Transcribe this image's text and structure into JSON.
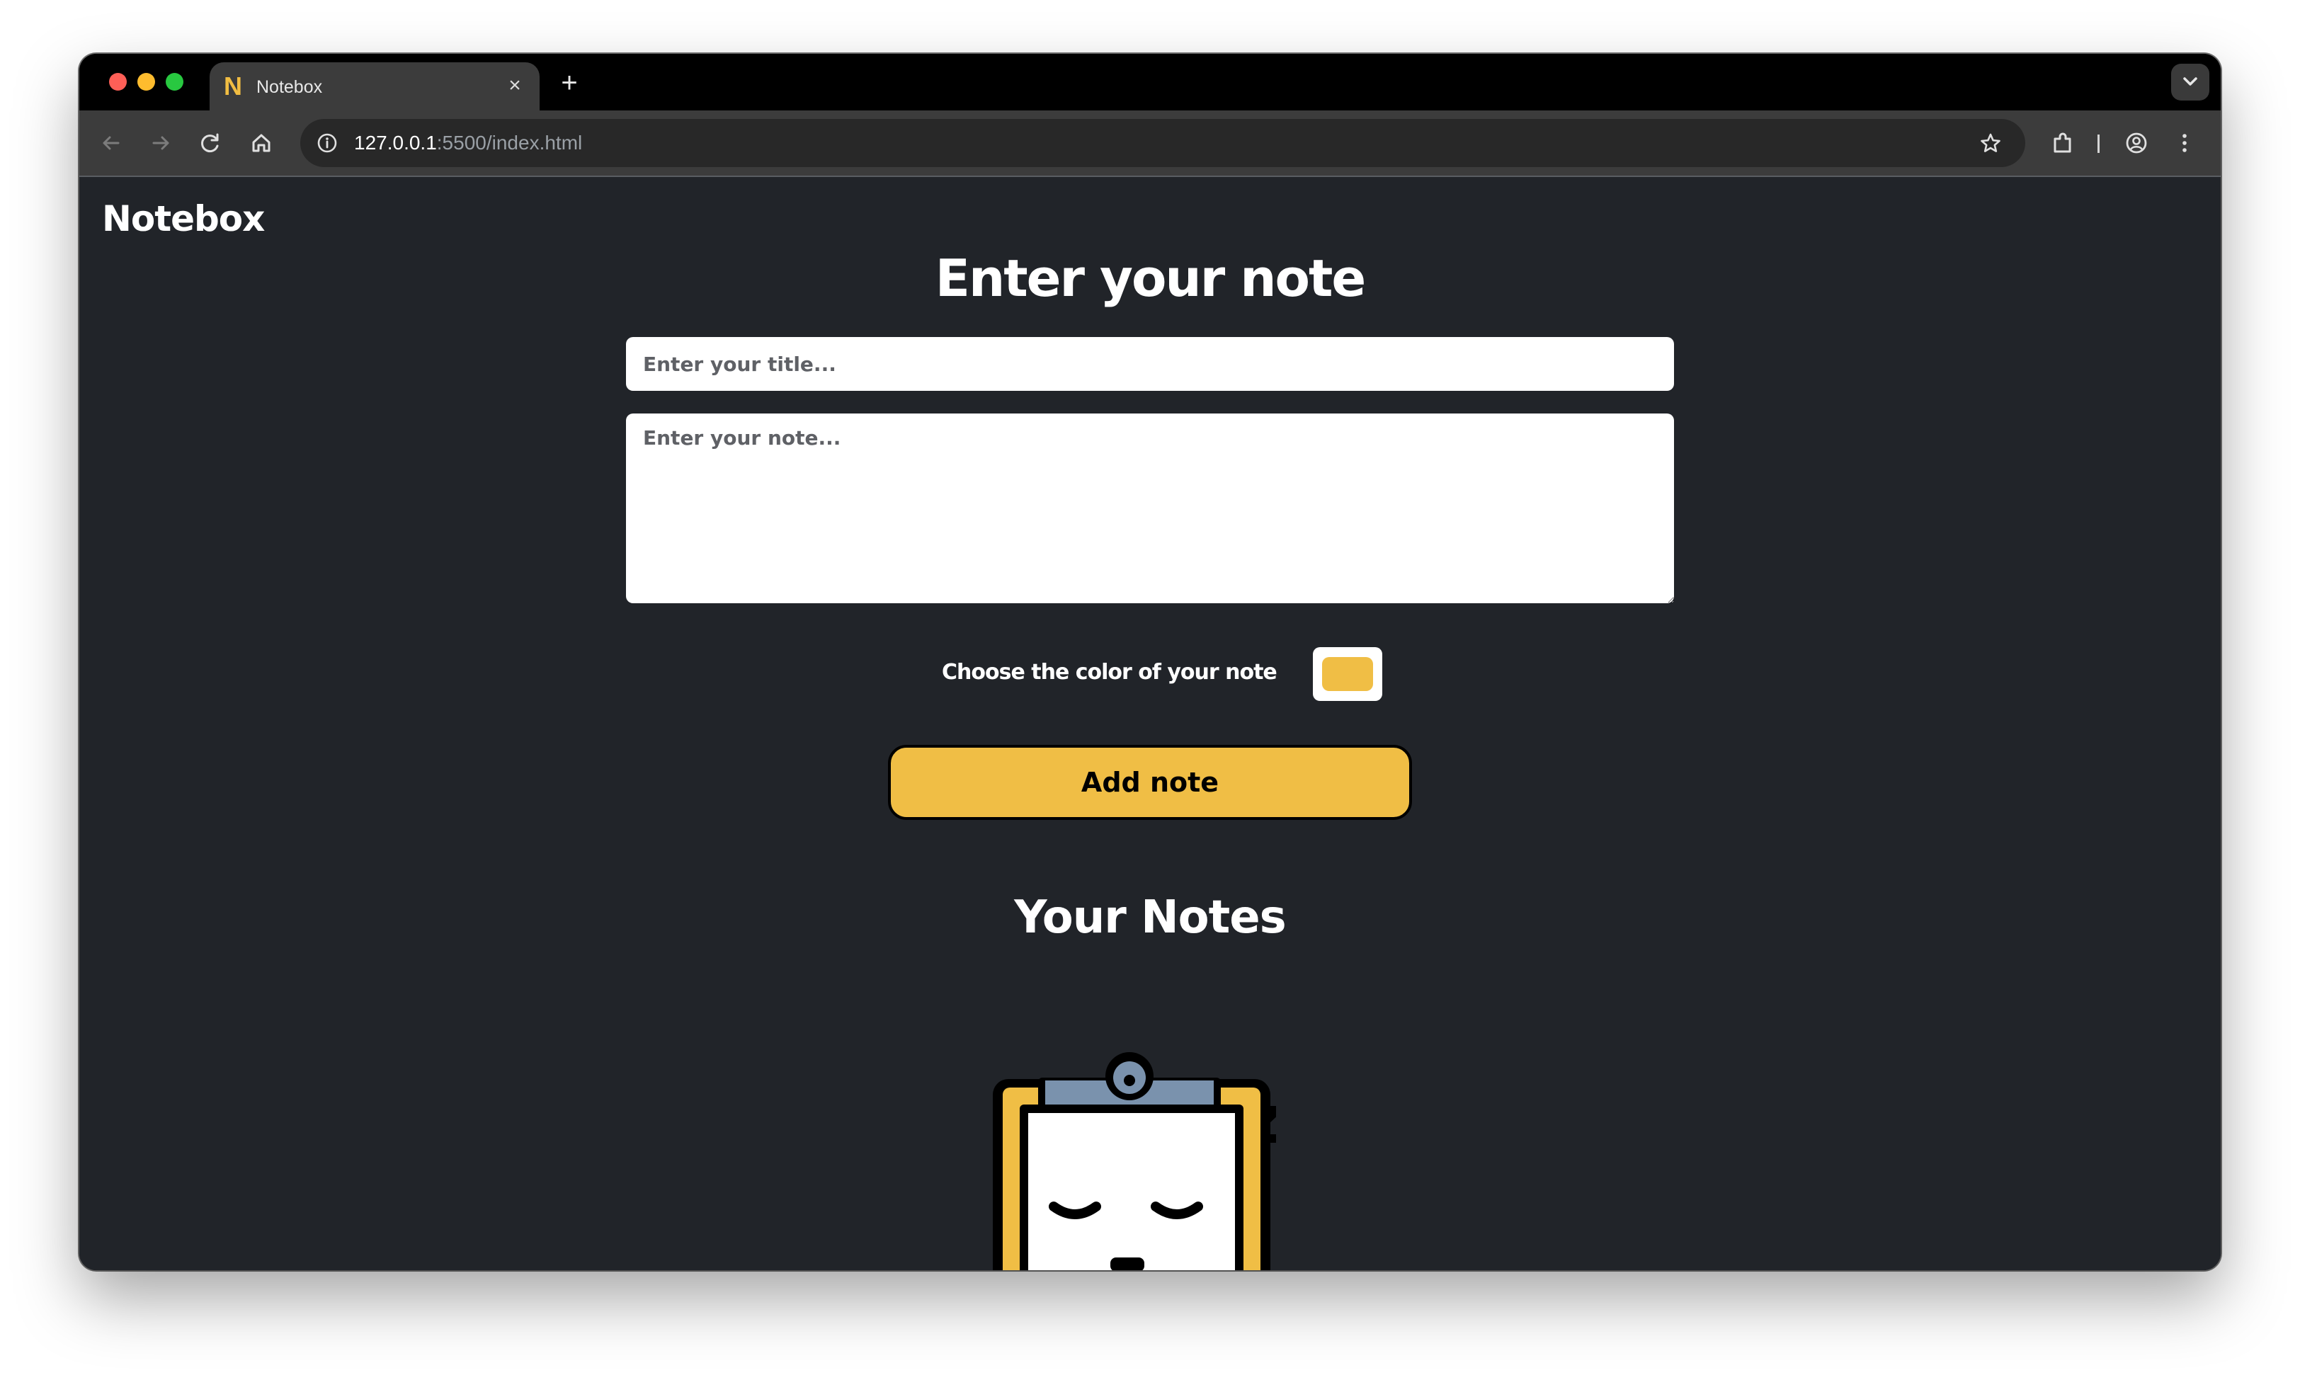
{
  "browser": {
    "tab": {
      "favicon": "N",
      "title": "Notebox",
      "close_icon": "×"
    },
    "new_tab_icon": "+",
    "url": {
      "host": "127.0.0.1",
      "path": ":5500/index.html"
    }
  },
  "app": {
    "brand": "Notebox",
    "heading": "Enter your note",
    "title_placeholder": "Enter your title...",
    "note_placeholder": "Enter your note...",
    "color_label": "Choose the color of your note",
    "selected_color": "#f0be45",
    "add_button": "Add note",
    "notes_heading": "Your Notes",
    "empty_state_icon": "sleeping-clipboard-illustration"
  },
  "theme": {
    "page_background": "#212429",
    "accent": "#f0be45",
    "clip_color": "#7a92ad"
  }
}
